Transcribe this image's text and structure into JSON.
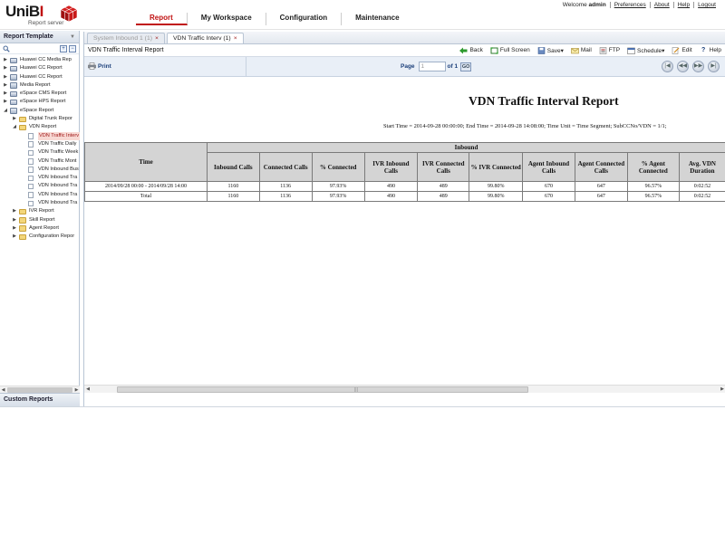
{
  "app": {
    "logo_main": "UniB",
    "logo_accent": "I",
    "logo_sub": "Report server"
  },
  "nav": [
    {
      "label": "Report",
      "active": true
    },
    {
      "label": "My Workspace",
      "active": false
    },
    {
      "label": "Configuration",
      "active": false
    },
    {
      "label": "Maintenance",
      "active": false
    }
  ],
  "toplinks": {
    "welcome_prefix": "Welcome ",
    "user": "admin",
    "links": [
      "Preferences",
      "About",
      "Help",
      "Logout"
    ]
  },
  "left_panel": {
    "title": "Report Template",
    "custom_reports": "Custom Reports",
    "tree": [
      {
        "label": "Huawei CC Media Rep",
        "level": 0,
        "toggle": "▶",
        "icon": "db",
        "selected": false
      },
      {
        "label": "Huawei CC Report",
        "level": 0,
        "toggle": "▶",
        "icon": "db",
        "selected": false
      },
      {
        "label": "Huawei CC Report",
        "level": 0,
        "toggle": "▶",
        "icon": "db",
        "selected": false
      },
      {
        "label": "Media Report",
        "level": 0,
        "toggle": "▶",
        "icon": "db",
        "selected": false
      },
      {
        "label": "eSpace CMS  Report",
        "level": 0,
        "toggle": "▶",
        "icon": "db",
        "selected": false
      },
      {
        "label": "eSpace HPS Report",
        "level": 0,
        "toggle": "▶",
        "icon": "db",
        "selected": false
      },
      {
        "label": "eSpace Report",
        "level": 0,
        "toggle": "◢",
        "icon": "db",
        "selected": false
      },
      {
        "label": "Digital Trunk Repor",
        "level": 1,
        "toggle": "▶",
        "icon": "folder",
        "selected": false
      },
      {
        "label": "VDN Report",
        "level": 1,
        "toggle": "◢",
        "icon": "folder",
        "selected": false
      },
      {
        "label": "VDN Traffic Interv",
        "level": 2,
        "toggle": "",
        "icon": "doc",
        "selected": true
      },
      {
        "label": "VDN Traffic Daily",
        "level": 2,
        "toggle": "",
        "icon": "doc",
        "selected": false
      },
      {
        "label": "VDN Traffic Week",
        "level": 2,
        "toggle": "",
        "icon": "doc",
        "selected": false
      },
      {
        "label": "VDN Traffic Mont",
        "level": 2,
        "toggle": "",
        "icon": "doc",
        "selected": false
      },
      {
        "label": "VDN Inbound Bus",
        "level": 2,
        "toggle": "",
        "icon": "doc",
        "selected": false
      },
      {
        "label": "VDN Inbound Tra",
        "level": 2,
        "toggle": "",
        "icon": "doc",
        "selected": false
      },
      {
        "label": "VDN Inbound Tra",
        "level": 2,
        "toggle": "",
        "icon": "doc",
        "selected": false
      },
      {
        "label": "VDN Inbound Tra",
        "level": 2,
        "toggle": "",
        "icon": "doc",
        "selected": false
      },
      {
        "label": "VDN Inbound Tra",
        "level": 2,
        "toggle": "",
        "icon": "doc",
        "selected": false
      },
      {
        "label": "IVR Report",
        "level": 1,
        "toggle": "▶",
        "icon": "folder",
        "selected": false
      },
      {
        "label": "Skill Report",
        "level": 1,
        "toggle": "▶",
        "icon": "folder",
        "selected": false
      },
      {
        "label": "Agent Report",
        "level": 1,
        "toggle": "▶",
        "icon": "folder",
        "selected": false
      },
      {
        "label": "Configuration Repor",
        "level": 1,
        "toggle": "▶",
        "icon": "folder",
        "selected": false
      }
    ]
  },
  "tabs": [
    {
      "label": "System Inbound 1 (1)",
      "active": false
    },
    {
      "label": "VDN Traffic Interv (1)",
      "active": true
    }
  ],
  "tab_close": "×",
  "toolbar": {
    "title": "VDN Traffic Interval Report",
    "back": "Back",
    "full_screen": "Full Screen",
    "save": "Save▾",
    "mail": "Mail",
    "ftp": "FTP",
    "schedule": "Schedule▾",
    "edit": "Edit",
    "help": "Help"
  },
  "pager": {
    "print": "Print",
    "page_label": "Page",
    "page_value": "1",
    "of_label": "of 1",
    "go": "GO"
  },
  "report": {
    "title": "VDN Traffic Interval Report",
    "params": "Start Time = 2014-09-28 00:00:00; End Time = 2014-09-28 14:08:00; Time Unit = Time Segment; SubCCNo/VDN = 1/1;",
    "time_header": "Time",
    "group_header": "Inbound",
    "columns": [
      "Inbound Calls",
      "Connected Calls",
      "% Connected",
      "IVR Inbound Calls",
      "IVR Connected Calls",
      "% IVR Connected",
      "Agent Inbound Calls",
      "Agent Connected Calls",
      "% Agent Connected",
      "Avg. VDN Duration"
    ],
    "rows": [
      [
        "2014/09/28 00:00 - 2014/09/28 14:00",
        "1160",
        "1136",
        "97.93%",
        "490",
        "489",
        "99.80%",
        "670",
        "647",
        "96.57%",
        "0:02:52"
      ],
      [
        "Total",
        "1160",
        "1136",
        "97.93%",
        "490",
        "489",
        "99.80%",
        "670",
        "647",
        "96.57%",
        "0:02:52"
      ]
    ]
  },
  "colors": {
    "accent": "#c01010",
    "header_bg": "#d4d4d4",
    "panel_bg": "#e9eff7"
  }
}
